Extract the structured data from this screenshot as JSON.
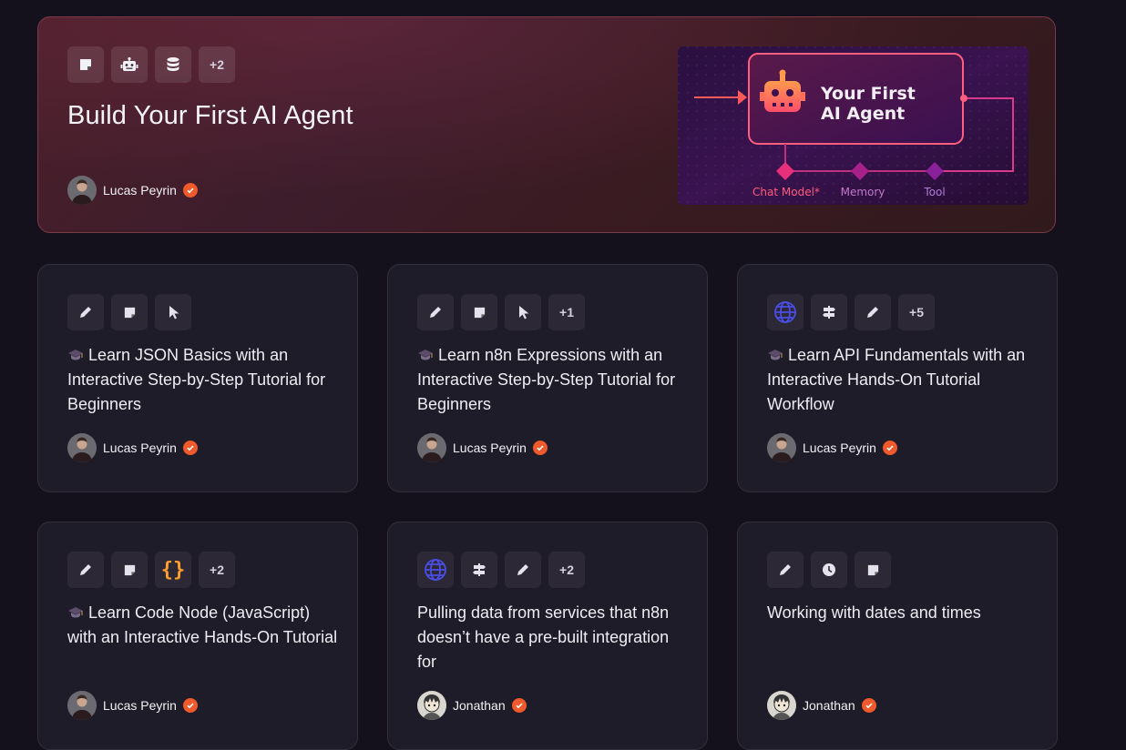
{
  "hero": {
    "title": "Build Your First AI Agent",
    "icons": [
      "sticky-note-icon",
      "robot-icon",
      "database-icon"
    ],
    "more": "+2",
    "author": "Lucas Peyrin",
    "image": {
      "title_line1": "Your First",
      "title_line2": "AI Agent",
      "ports": [
        "Chat Model*",
        "Memory",
        "Tool"
      ]
    }
  },
  "cards": [
    {
      "icons": [
        "pencil-icon",
        "sticky-note-icon",
        "cursor-icon"
      ],
      "more": "",
      "title": "Learn JSON Basics with an Interactive Step-by-Step Tutorial for Beginners",
      "author": "Lucas Peyrin"
    },
    {
      "icons": [
        "pencil-icon",
        "sticky-note-icon",
        "cursor-icon"
      ],
      "more": "+1",
      "title": "Learn n8n Expressions with an Interactive Step-by-Step Tutorial for Beginners",
      "author": "Lucas Peyrin"
    },
    {
      "icons": [
        "globe-icon",
        "signpost-icon",
        "pencil-icon"
      ],
      "more": "+5",
      "title": "Learn API Fundamentals with an Interactive Hands-On Tutorial Workflow",
      "author": "Lucas Peyrin"
    },
    {
      "icons": [
        "pencil-icon",
        "sticky-note-icon",
        "code-braces-icon"
      ],
      "more": "+2",
      "title": "Learn Code Node (JavaScript) with an Interactive Hands-On Tutorial",
      "author": "Lucas Peyrin"
    },
    {
      "icons": [
        "globe-icon",
        "signpost-icon",
        "pencil-icon"
      ],
      "more": "+2",
      "title": "Pulling data from services that n8n doesn’t have a pre-built integration for",
      "author": "Jonathan"
    },
    {
      "icons": [
        "pencil-icon",
        "clock-icon",
        "sticky-note-icon"
      ],
      "more": "",
      "title": "Working with dates and times",
      "author": "Jonathan"
    }
  ]
}
